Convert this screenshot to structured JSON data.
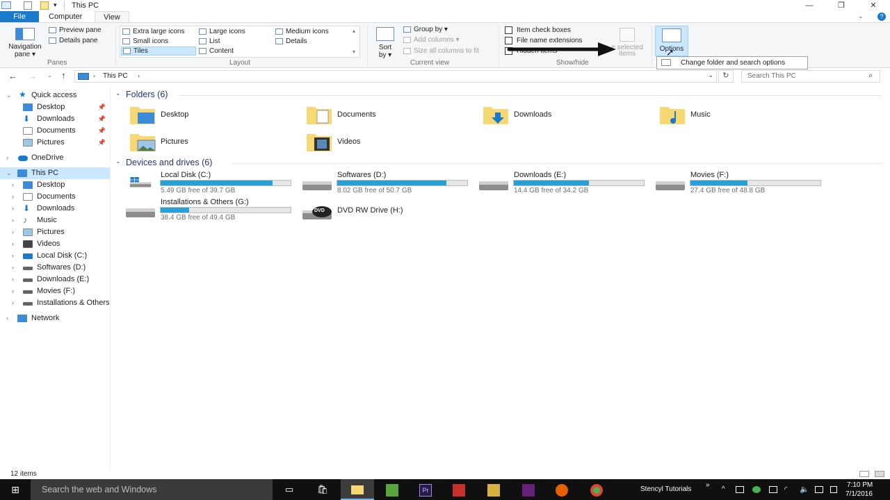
{
  "window": {
    "title": "This PC",
    "minimize": "—",
    "maximize": "❐",
    "close": "✕"
  },
  "ribbon_tabs": [
    "File",
    "Computer",
    "View"
  ],
  "ribbon": {
    "panes": {
      "navigation_pane": "Navigation",
      "navigation_pane_2": "pane",
      "preview_pane": "Preview pane",
      "details_pane": "Details pane",
      "group_label": "Panes"
    },
    "layout": {
      "items": [
        "Extra large icons",
        "Large icons",
        "Medium icons",
        "Small icons",
        "List",
        "Details",
        "Tiles",
        "Content"
      ],
      "selected": "Tiles",
      "group_label": "Layout"
    },
    "current_view": {
      "sort_by": "Sort",
      "sort_by_2": "by",
      "group_by": "Group by",
      "add_columns": "Add columns",
      "size_columns": "Size all columns to fit",
      "group_label": "Current view"
    },
    "show_hide": {
      "item_check_boxes": "Item check boxes",
      "file_name_extensions": "File name extensions",
      "hidden_items": "Hidden items",
      "hide_selected": "e selected",
      "hide_selected_2": "items",
      "group_label": "Show/hide"
    },
    "options": "Options",
    "tooltip": "Change folder and search options"
  },
  "address": {
    "path": "This PC",
    "search_placeholder": "Search This PC"
  },
  "nav": {
    "quick_access": "Quick access",
    "quick_items": [
      "Desktop",
      "Downloads",
      "Documents",
      "Pictures"
    ],
    "onedrive": "OneDrive",
    "this_pc": "This PC",
    "pc_items": [
      "Desktop",
      "Documents",
      "Downloads",
      "Music",
      "Pictures",
      "Videos",
      "Local Disk (C:)",
      "Softwares (D:)",
      "Downloads (E:)",
      "Movies (F:)",
      "Installations & Others (G:)"
    ],
    "network": "Network"
  },
  "folders": {
    "header": "Folders (6)",
    "items": [
      "Desktop",
      "Documents",
      "Downloads",
      "Music",
      "Pictures",
      "Videos"
    ]
  },
  "drives": {
    "header": "Devices and drives (6)",
    "items": [
      {
        "name": "Local Disk (C:)",
        "free": "5.49 GB free of 39.7 GB",
        "used_fraction": 0.86
      },
      {
        "name": "Softwares (D:)",
        "free": "8.02 GB free of 50.7 GB",
        "used_fraction": 0.84
      },
      {
        "name": "Downloads (E:)",
        "free": "14.4 GB free of 34.2 GB",
        "used_fraction": 0.58
      },
      {
        "name": "Movies (F:)",
        "free": "27.4 GB free of 48.8 GB",
        "used_fraction": 0.44
      },
      {
        "name": "Installations & Others (G:)",
        "free": "38.4 GB free of 49.4 GB",
        "used_fraction": 0.22
      }
    ],
    "dvd": {
      "name": "DVD RW Drive (H:)",
      "badge": "DVD"
    }
  },
  "status": {
    "items": "12 items"
  },
  "taskbar": {
    "search": "Search the web and Windows",
    "stencyl": "Stencyl Tutorials",
    "time": "7:10 PM",
    "date": "7/1/2016",
    "chevron": "»"
  },
  "colors": {
    "accent": "#1979ca",
    "bar_fill": "#26a0da",
    "selection": "#cce8ff",
    "folder": "#f8d775"
  }
}
